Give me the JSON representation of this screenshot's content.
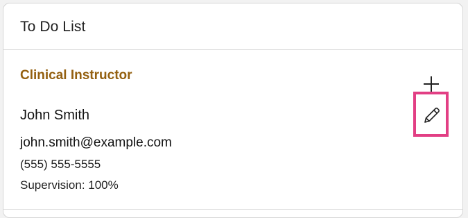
{
  "card": {
    "title": "To Do List"
  },
  "section": {
    "heading": "Clinical Instructor",
    "heading_color": "#946010"
  },
  "contact": {
    "name": "John Smith",
    "email": "john.smith@example.com",
    "phone": "(555) 555-5555",
    "supervision": "Supervision: 100%"
  },
  "actions": {
    "add_icon": "plus-icon",
    "edit_icon": "pencil-icon",
    "highlight_color": "#e23f84"
  }
}
